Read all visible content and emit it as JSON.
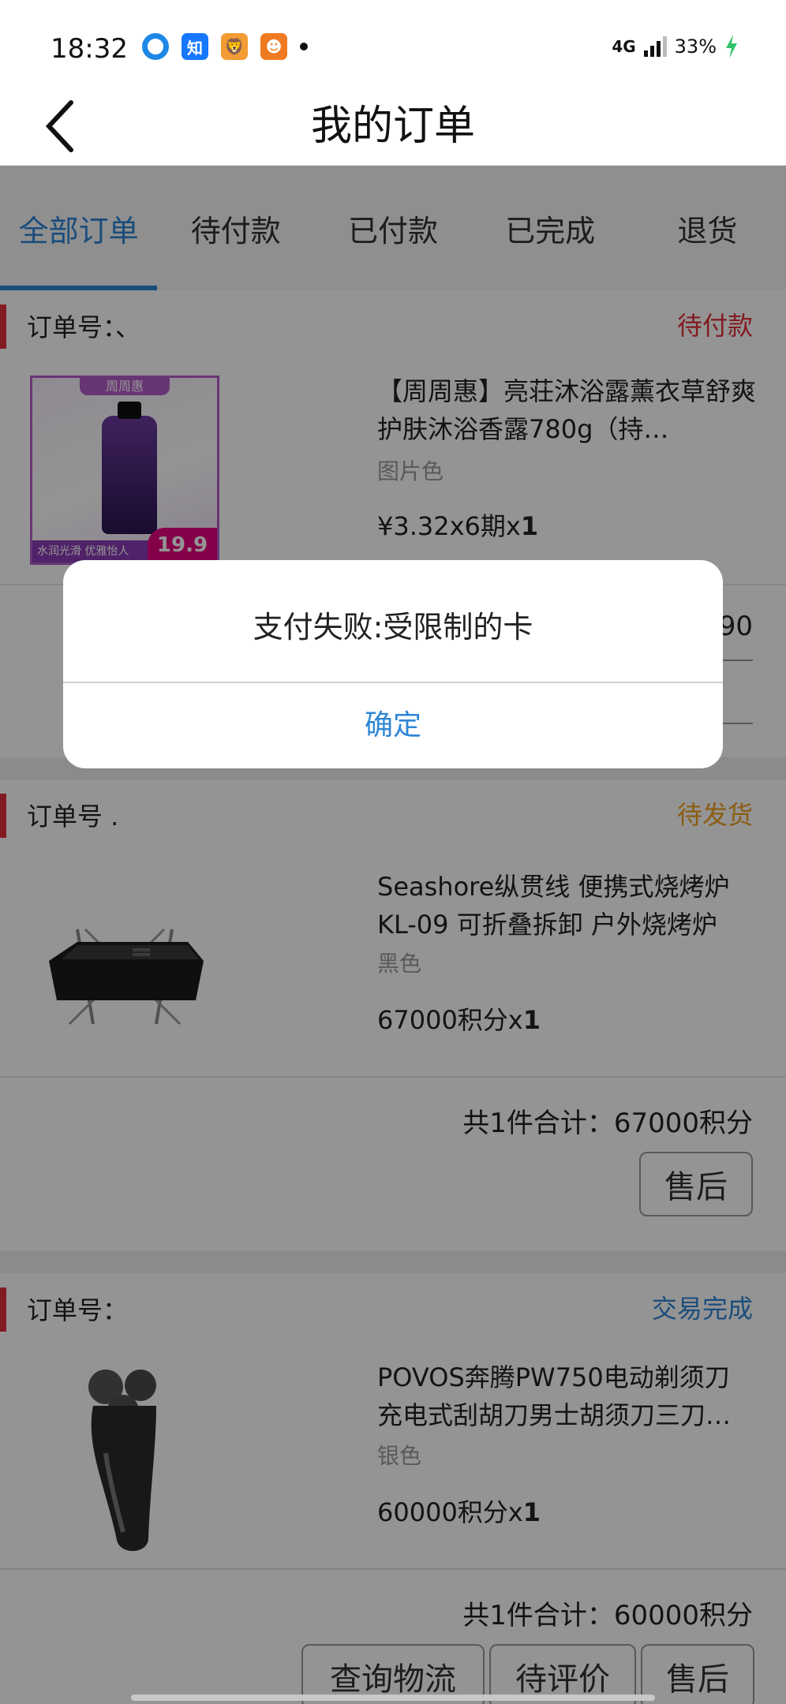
{
  "status_bar": {
    "time": "18:32",
    "network": "4G",
    "battery": "33%",
    "icons": [
      "browser-icon",
      "zhihu-icon",
      "app-icon",
      "app-icon-2"
    ],
    "zhihu_label": "知"
  },
  "nav": {
    "title": "我的订单",
    "back_icon": "chevron-left-icon"
  },
  "tabs": [
    {
      "label": "全部订单",
      "active": true
    },
    {
      "label": "待付款",
      "active": false
    },
    {
      "label": "已付款",
      "active": false
    },
    {
      "label": "已完成",
      "active": false
    },
    {
      "label": "退货",
      "active": false
    }
  ],
  "orders": [
    {
      "order_no": "订单号：、",
      "status": "待付款",
      "status_color": "#e0303a",
      "product_title": "【周周惠】亮荘沐浴露薰衣草舒爽护肤沐浴香露780g（持…",
      "spec": "图片色",
      "price": "¥3.32x6期x",
      "qty": "1",
      "total_fragment": "90",
      "image_badge": "周周惠",
      "image_price": "19.9",
      "image_slogan": "水润光滑 优雅怡人"
    },
    {
      "order_no": "订单号 .",
      "status": "待发货",
      "status_color": "#f0a020",
      "product_title": "Seashore纵贯线 便携式烧烤炉 KL-09 可折叠拆卸 户外烧烤炉",
      "spec": "黑色",
      "price": "67000积分x",
      "qty": "1",
      "total": "共1件合计：67000积分",
      "buttons": [
        "售后"
      ]
    },
    {
      "order_no": "订单号：",
      "status": "交易完成",
      "status_color": "#2f86d6",
      "product_title": "POVOS奔腾PW750电动剃须刀 充电式刮胡刀男士胡须刀三刀…",
      "spec": "银色",
      "price": "60000积分x",
      "qty": "1",
      "total": "共1件合计：60000积分",
      "buttons": [
        "查询物流",
        "待评价",
        "售后"
      ]
    }
  ],
  "dialog": {
    "message": "支付失败:受限制的卡",
    "confirm": "确定"
  },
  "colors": {
    "accent": "#2f86d6",
    "pending": "#e0303a",
    "shipping": "#f0a020"
  }
}
